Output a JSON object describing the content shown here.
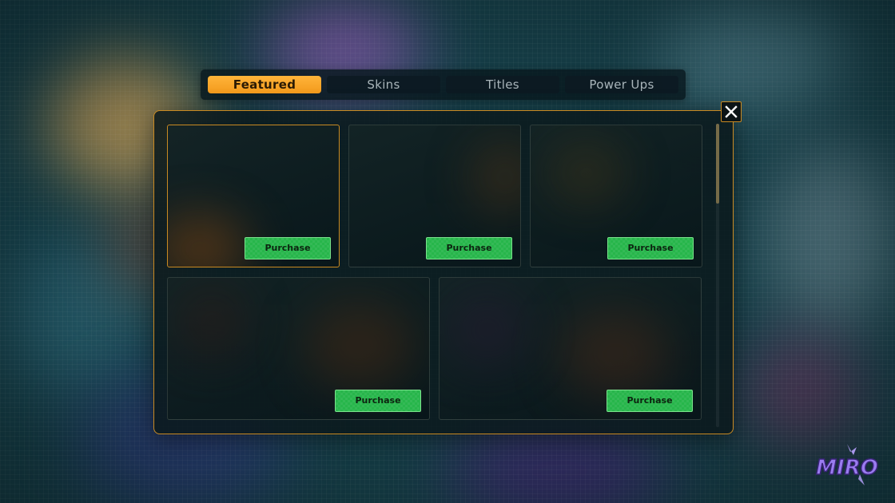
{
  "tabs": [
    {
      "label": "Featured",
      "active": true
    },
    {
      "label": "Skins",
      "active": false
    },
    {
      "label": "Titles",
      "active": false
    },
    {
      "label": "Power Ups",
      "active": false
    }
  ],
  "close_icon": "close-icon",
  "cards": [
    {
      "purchase_label": "Purchase",
      "selected": true
    },
    {
      "purchase_label": "Purchase",
      "selected": false
    },
    {
      "purchase_label": "Purchase",
      "selected": false
    },
    {
      "purchase_label": "Purchase",
      "selected": false
    },
    {
      "purchase_label": "Purchase",
      "selected": false
    }
  ],
  "logo": {
    "text": "MIRO",
    "color": "#9a7cf0"
  },
  "colors": {
    "accent": "#f39a1c",
    "panel_border": "#c98a22",
    "purchase_green": "#27b64b"
  }
}
